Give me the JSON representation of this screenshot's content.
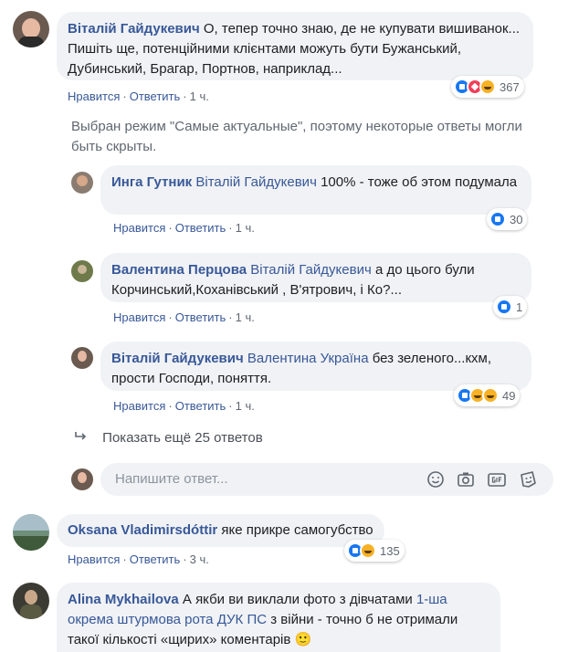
{
  "comments": [
    {
      "author": "Віталій Гайдукевич",
      "text": "О, тепер точно знаю, де не купувати вишиванок... Пишіть ще, потенційними клієнтами можуть бути Бужанський, Дубинський, Брагар, Портнов, наприклад...",
      "like": "Нравится",
      "reply": "Ответить",
      "time": "1 ч.",
      "reactions": "367"
    },
    {
      "author": "Oksana Vladimirsdóttir",
      "text": "яке прикре самогубство",
      "like": "Нравится",
      "reply": "Ответить",
      "time": "3 ч.",
      "reactions": "135"
    },
    {
      "author": "Alina Mykhailova",
      "text_before": "А якби ви виклали фото з дівчатами",
      "mention": "1-ша окрема штурмова рота ДУК ПС",
      "text_after": "з війни - точно б не отримали такої кількості «щирих» коментарів 🙂"
    }
  ],
  "notice": "Выбран режим \"Самые актуальные\", поэтому некоторые ответы могли быть скрыты.",
  "replies": [
    {
      "author": "Инга Гутник",
      "mention": "Віталій Гайдукевич",
      "text": "100% - тоже об этом подумала",
      "like": "Нравится",
      "reply": "Ответить",
      "time": "1 ч.",
      "reactions": "30"
    },
    {
      "author": "Валентина Перцова",
      "mention": "Віталій Гайдукевич",
      "text": "а до цього були Корчинський,Коханівський , В'ятрович, і Ко?...",
      "like": "Нравится",
      "reply": "Ответить",
      "time": "1 ч.",
      "reactions": "1"
    },
    {
      "author": "Віталій Гайдукевич",
      "mention": "Валентина Україна",
      "text": "без зеленого...кхм, прости Господи, поняття.",
      "like": "Нравится",
      "reply": "Ответить",
      "time": "1 ч.",
      "reactions": "49"
    }
  ],
  "show_more": "Показать ещё 25 ответов",
  "composer": {
    "placeholder": "Напишите ответ..."
  },
  "colors": {
    "link": "#385898",
    "bubble": "#f0f2f5",
    "meta": "#606770"
  },
  "icons": [
    "emoji-icon",
    "camera-icon",
    "gif-icon",
    "sticker-icon",
    "reply-arrow-icon"
  ]
}
